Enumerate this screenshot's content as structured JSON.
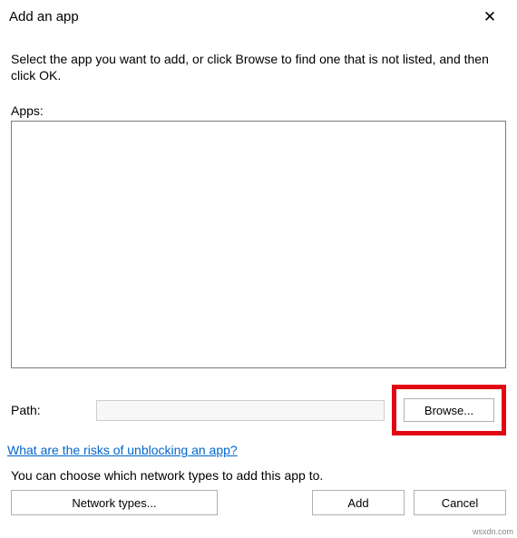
{
  "window": {
    "title": "Add an app",
    "close_glyph": "✕"
  },
  "instruction": "Select the app you want to add, or click Browse to find one that is not listed, and then click OK.",
  "apps_label": "Apps:",
  "path": {
    "label": "Path:",
    "value": "",
    "browse_label": "Browse..."
  },
  "risk_link": "What are the risks of unblocking an app?",
  "network_text": "You can choose which network types to add this app to.",
  "buttons": {
    "network_types": "Network types...",
    "add": "Add",
    "cancel": "Cancel"
  },
  "watermark": "wsxdn.com"
}
